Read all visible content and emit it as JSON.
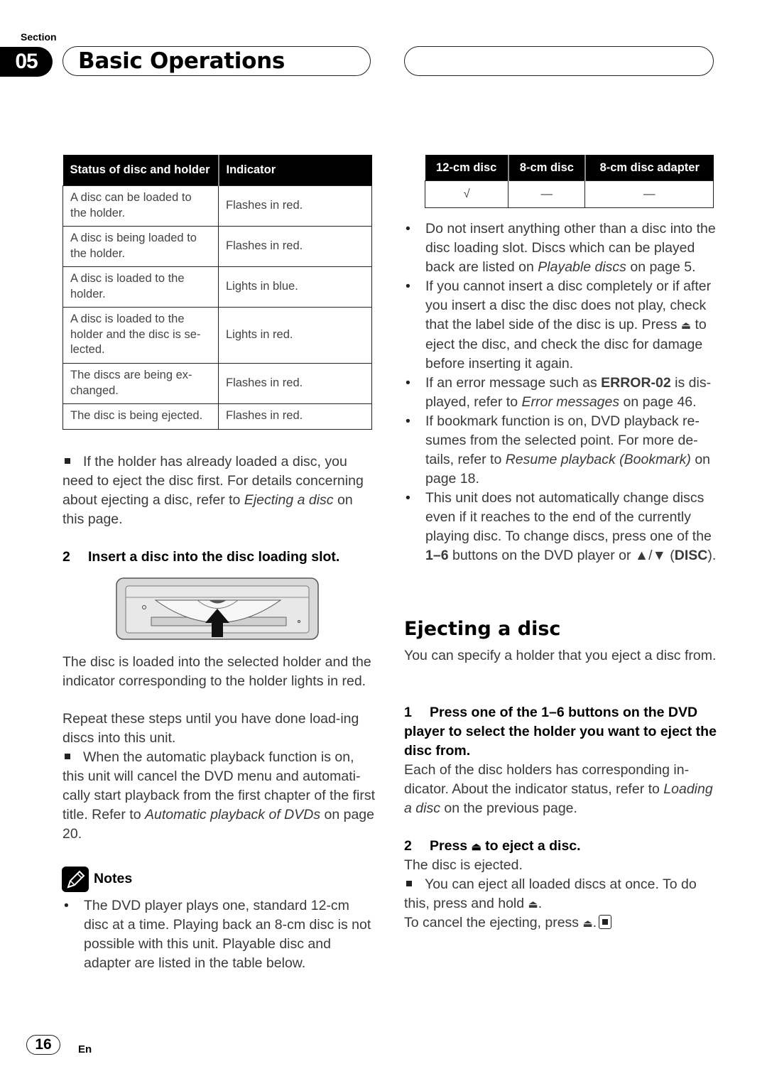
{
  "header": {
    "section_label": "Section",
    "section_number": "05",
    "title": "Basic Operations"
  },
  "status_table": {
    "headers": [
      "Status of disc and holder",
      "Indicator"
    ],
    "rows": [
      {
        "status": "A disc can be loaded to the holder.",
        "indicator": "Flashes in red."
      },
      {
        "status": "A disc is being loaded to the holder.",
        "indicator": "Flashes in red."
      },
      {
        "status": "A disc is loaded to the holder.",
        "indicator": "Lights in blue."
      },
      {
        "status": "A disc is loaded to the holder and the disc is se-lected.",
        "indicator": "Lights in red."
      },
      {
        "status": "The discs are being ex-changed.",
        "indicator": "Flashes in red."
      },
      {
        "status": "The disc is being ejected.",
        "indicator": "Flashes in red."
      }
    ]
  },
  "left": {
    "note1": "If the holder has already loaded a disc, you need to eject the disc first. For details concerning about ejecting a disc, refer to",
    "note1_link": "Ejecting a disc",
    "note1_tail": "on this page.",
    "step2_num": "2",
    "step2_text": "Insert a disc into the disc loading slot.",
    "para1": "The disc is loaded into the selected holder and the indicator corresponding to the holder lights in red.",
    "para2": "Repeat these steps until you have done load-ing discs into this unit.",
    "note2": "When the automatic playback function is on, this unit will cancel the DVD menu and automati-cally start playback from the first chapter of the first title. Refer to",
    "note2_link": "Automatic playback of DVDs",
    "note2_tail": "on page 20.",
    "notes_title": "Notes",
    "notes_bullet": "The DVD player plays one, standard 12-cm disc at a time. Playing back an 8-cm disc is not possible with this unit. Playable disc and adapter are listed in the table below."
  },
  "disc_table": {
    "headers": [
      "12-cm disc",
      "8-cm disc",
      "8-cm disc adapter"
    ],
    "values": [
      "√",
      "—",
      "—"
    ]
  },
  "right": {
    "bullets": [
      {
        "pre": "Do not insert anything other than a disc into the disc loading slot. Discs which can be played back are listed on",
        "link": "Playable discs",
        "post": "on page 5."
      },
      {
        "pre": "If you cannot insert a disc completely or if after you insert a disc the disc does not play, check that the label side of the disc is up. Press",
        "icon": "⏏",
        "post": "to eject the disc, and check the disc for damage before inserting it again."
      },
      {
        "pre": "If an error message such as",
        "bold": "ERROR-02",
        "mid": "is dis-played, refer to",
        "link": "Error messages",
        "post": "on page 46."
      },
      {
        "pre": "If bookmark function is on, DVD playback re-sumes from the selected point. For more de-tails, refer to",
        "link": "Resume playback (Bookmark)",
        "post": "on page 18."
      },
      {
        "pre": "This unit does not automatically change discs even if it reaches to the end of the currently playing disc. To change discs, press one of the",
        "bold": "1–6",
        "mid": "buttons on the DVD player or ▲/▼ (",
        "bold2": "DISC",
        "post": ")."
      }
    ],
    "heading": "Ejecting a disc",
    "intro": "You can specify a holder that you eject a disc from.",
    "step1_num": "1",
    "step1_text": "Press one of the 1–6 buttons on the DVD player to select the holder you want to eject the disc from.",
    "step1_body": "Each of the disc holders has corresponding in-dicator. About the indicator status, refer to",
    "step1_link": "Loading a disc",
    "step1_tail": "on the previous page.",
    "step2_num": "2",
    "step2_pre": "Press",
    "step2_icon": "⏏",
    "step2_post": "to eject a disc.",
    "step2_body": "The disc is ejected.",
    "note": "You can eject all loaded discs at once. To do this, press and hold",
    "note_tail": ".",
    "cancel": "To cancel the ejecting, press",
    "cancel_tail": "."
  },
  "footer": {
    "page_number": "16",
    "language": "En"
  }
}
